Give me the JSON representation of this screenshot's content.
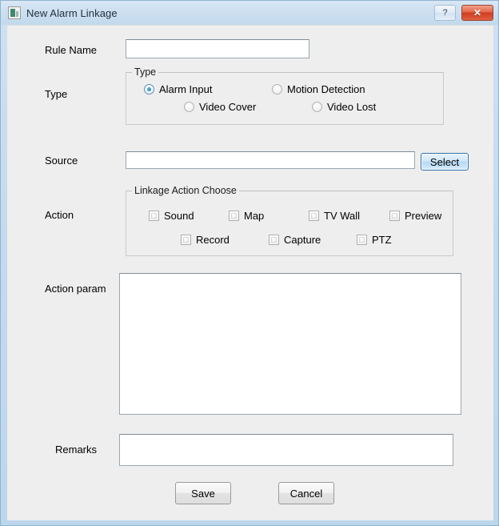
{
  "window": {
    "title": "New Alarm Linkage",
    "icon": "application-icon",
    "help_label": "?",
    "close_label": "✕",
    "accent_blue": "#2b7fc0",
    "frame_blue": "#c3d9ee",
    "client_bg": "#eeeeee",
    "close_red": "#cf3d21"
  },
  "form": {
    "rule_name": {
      "label": "Rule Name",
      "value": "",
      "placeholder": ""
    },
    "type": {
      "label": "Type",
      "group_title": "Type",
      "selected": "Alarm Input",
      "options": [
        {
          "label": "Alarm Input",
          "checked": true
        },
        {
          "label": "Motion Detection",
          "checked": false
        },
        {
          "label": "Video Cover",
          "checked": false
        },
        {
          "label": "Video Lost",
          "checked": false
        }
      ]
    },
    "source": {
      "label": "Source",
      "value": "",
      "placeholder": "",
      "select_button": "Select"
    },
    "action": {
      "label": "Action",
      "group_title": "Linkage Action Choose",
      "options": [
        {
          "label": "Sound",
          "checked": false
        },
        {
          "label": "Map",
          "checked": false
        },
        {
          "label": "TV Wall",
          "checked": false
        },
        {
          "label": "Preview",
          "checked": false
        },
        {
          "label": "Record",
          "checked": false
        },
        {
          "label": "Capture",
          "checked": false
        },
        {
          "label": "PTZ",
          "checked": false
        }
      ]
    },
    "action_param": {
      "label": "Action param",
      "value": "",
      "placeholder": ""
    },
    "remarks": {
      "label": "Remarks",
      "value": "",
      "placeholder": ""
    }
  },
  "footer": {
    "save_label": "Save",
    "cancel_label": "Cancel"
  }
}
